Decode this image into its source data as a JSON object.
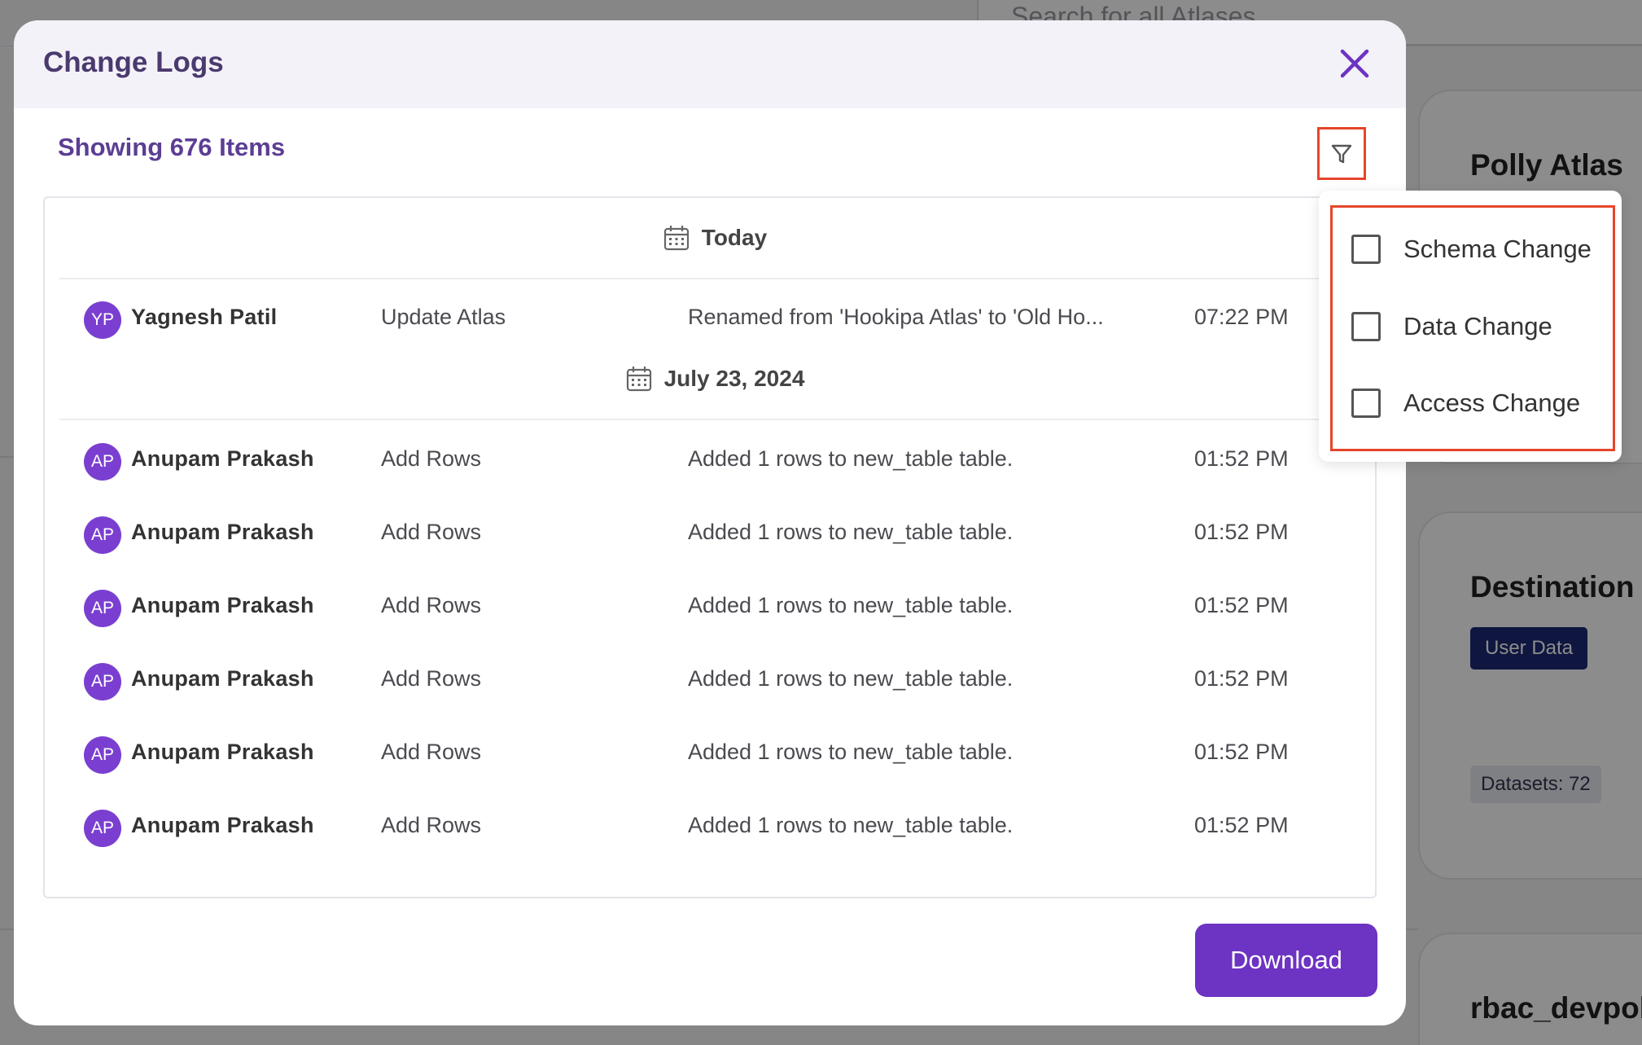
{
  "background": {
    "search_placeholder": "Search for all Atlases",
    "cards": [
      {
        "title": "Polly Atlas"
      },
      {
        "title": "Destination A",
        "tag": "User Data",
        "stat": "Datasets: 72"
      },
      {
        "title": "rbac_devpol"
      }
    ]
  },
  "modal": {
    "title": "Change Logs",
    "summary": "Showing 676 Items",
    "groups": [
      {
        "date": "Today",
        "rows": [
          {
            "initials": "YP",
            "user": "Yagnesh Patil",
            "action": "Update Atlas",
            "description": "Renamed from 'Hookipa Atlas' to 'Old Ho...",
            "time": "07:22 PM"
          }
        ]
      },
      {
        "date": "July 23, 2024",
        "rows": [
          {
            "initials": "AP",
            "user": "Anupam Prakash",
            "action": "Add Rows",
            "description": "Added 1 rows to new_table table.",
            "time": "01:52 PM"
          },
          {
            "initials": "AP",
            "user": "Anupam Prakash",
            "action": "Add Rows",
            "description": "Added 1 rows to new_table table.",
            "time": "01:52 PM"
          },
          {
            "initials": "AP",
            "user": "Anupam Prakash",
            "action": "Add Rows",
            "description": "Added 1 rows to new_table table.",
            "time": "01:52 PM"
          },
          {
            "initials": "AP",
            "user": "Anupam Prakash",
            "action": "Add Rows",
            "description": "Added 1 rows to new_table table.",
            "time": "01:52 PM"
          },
          {
            "initials": "AP",
            "user": "Anupam Prakash",
            "action": "Add Rows",
            "description": "Added 1 rows to new_table table.",
            "time": "01:52 PM"
          },
          {
            "initials": "AP",
            "user": "Anupam Prakash",
            "action": "Add Rows",
            "description": "Added 1 rows to new_table table.",
            "time": "01:52 PM"
          }
        ]
      }
    ],
    "download_label": "Download"
  },
  "filter_dropdown": {
    "options": [
      {
        "label": "Schema Change",
        "checked": false
      },
      {
        "label": "Data Change",
        "checked": false
      },
      {
        "label": "Access Change",
        "checked": false
      }
    ]
  },
  "colors": {
    "accent": "#6d33c2",
    "highlight": "#e6452b",
    "avatar": "#7a3fd0"
  }
}
